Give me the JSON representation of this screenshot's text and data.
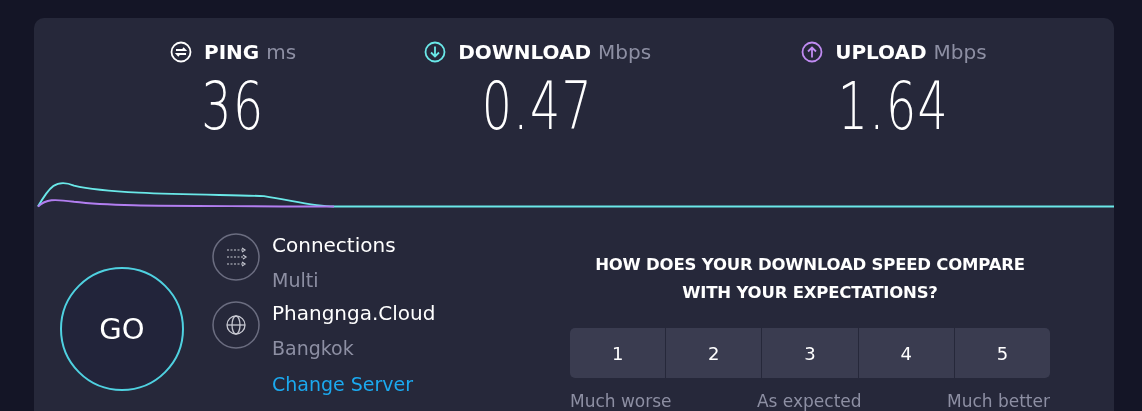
{
  "metrics": [
    {
      "kind": "ping",
      "label": "PING",
      "unit": "ms",
      "value": "36"
    },
    {
      "kind": "download",
      "label": "DOWNLOAD",
      "unit": "Mbps",
      "value": "0.47"
    },
    {
      "kind": "upload",
      "label": "UPLOAD",
      "unit": "Mbps",
      "value": "1.64"
    }
  ],
  "go_button": "GO",
  "info": [
    {
      "kind": "connections",
      "title": "Connections",
      "subtitle": "Multi"
    },
    {
      "kind": "server",
      "title": "Phangnga.Cloud",
      "subtitle": "Bangkok",
      "link": "Change Server"
    }
  ],
  "survey": {
    "question": "HOW DOES YOUR DOWNLOAD SPEED COMPARE WITH YOUR EXPECTATIONS?",
    "options": [
      "1",
      "2",
      "3",
      "4",
      "5"
    ],
    "scale_labels": [
      "Much worse",
      "As expected",
      "Much better"
    ]
  }
}
